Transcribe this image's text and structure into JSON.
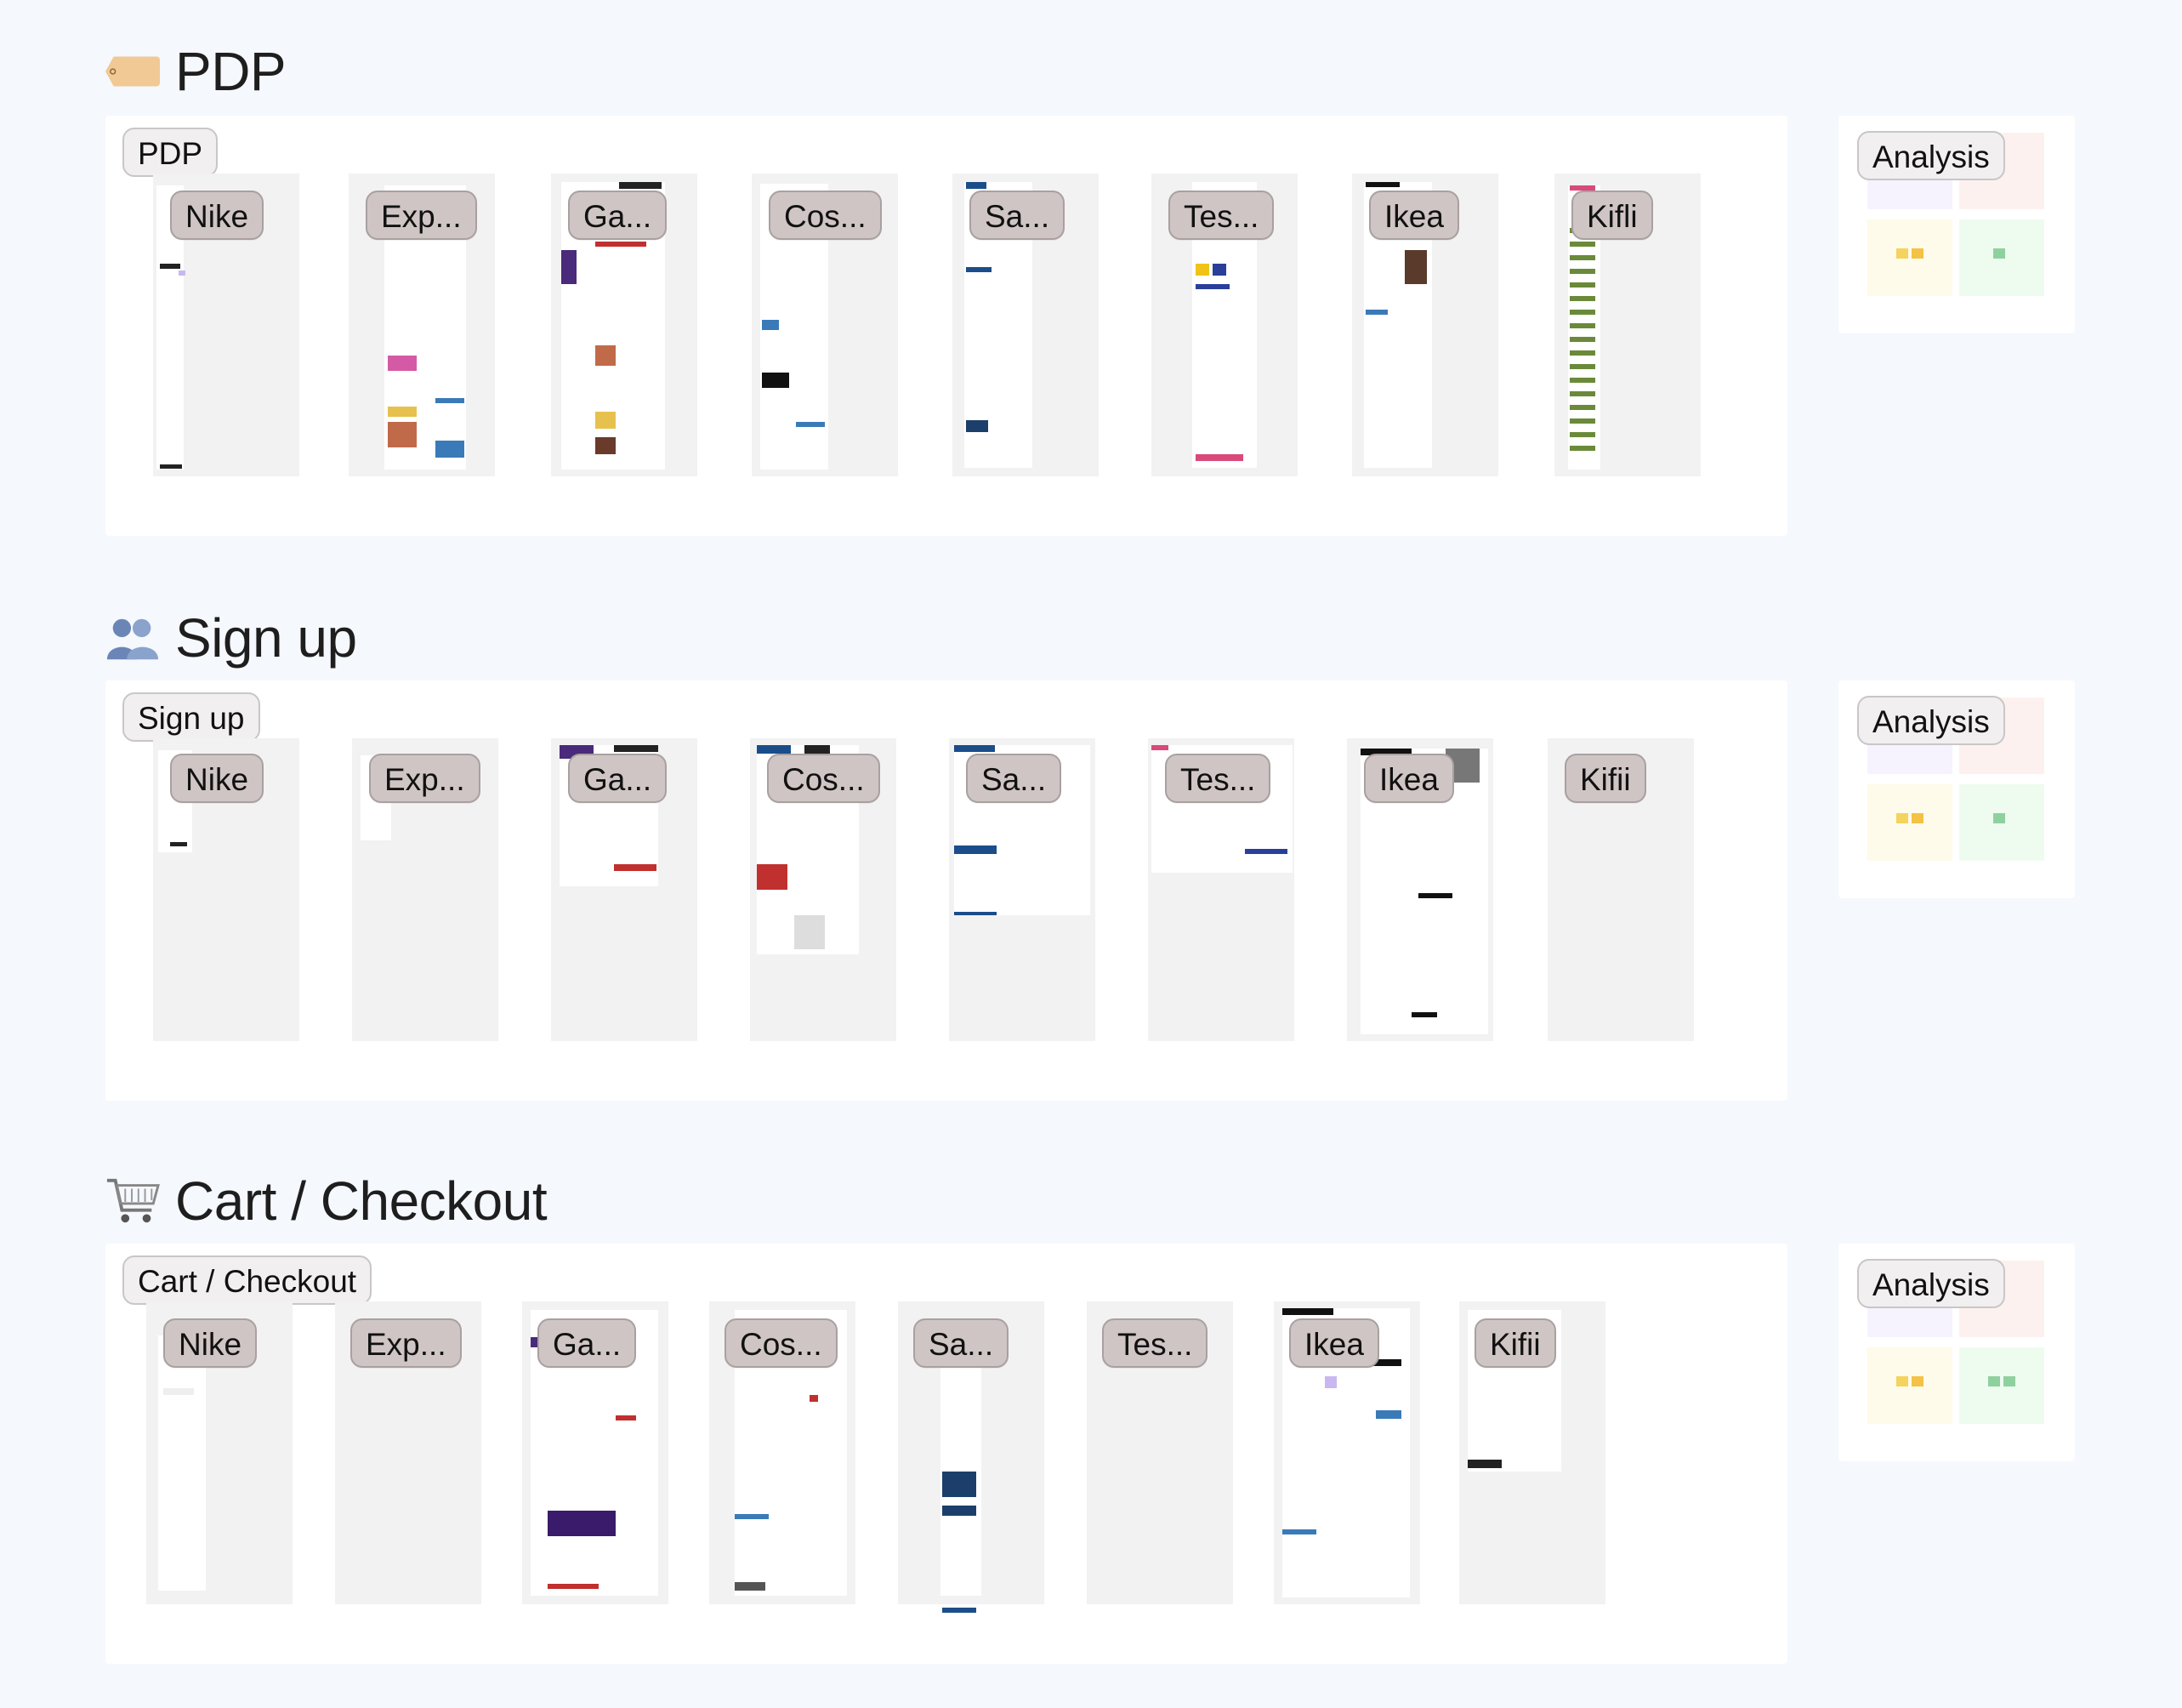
{
  "sections": [
    {
      "id": "pdp",
      "title": "PDP",
      "icon": "price-tag-icon",
      "frame_label": "PDP",
      "cards": [
        "Nike",
        "Exp...",
        "Ga...",
        "Cos...",
        "Sa...",
        "Tes...",
        "Ikea",
        "Kifli"
      ],
      "analysis_label": "Analysis"
    },
    {
      "id": "signup",
      "title": "Sign up",
      "icon": "users-icon",
      "frame_label": "Sign up",
      "cards": [
        "Nike",
        "Exp...",
        "Ga...",
        "Cos...",
        "Sa...",
        "Tes...",
        "Ikea",
        "Kifii"
      ],
      "analysis_label": "Analysis"
    },
    {
      "id": "cart",
      "title": "Cart / Checkout",
      "icon": "shopping-cart-icon",
      "frame_label": "Cart / Checkout",
      "cards": [
        "Nike",
        "Exp...",
        "Ga...",
        "Cos...",
        "Sa...",
        "Tes...",
        "Ikea",
        "Kifii"
      ],
      "analysis_label": "Analysis"
    }
  ],
  "colors": {
    "canvas": "#f5f8fc",
    "frame": "#ffffff",
    "label_bg": "#cfc5c4",
    "sticky_yellow": "#f4d35e",
    "sticky_green": "#8fd19e",
    "sticky_purple": "#c9b8f0"
  }
}
